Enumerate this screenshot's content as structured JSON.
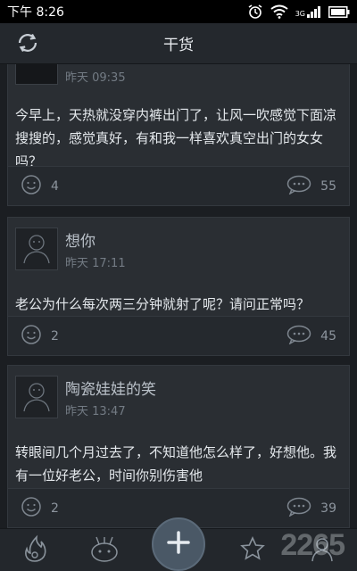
{
  "status_bar": {
    "time": "下午 8:26",
    "icons": [
      "alarm-icon",
      "wifi-icon",
      "signal-icon",
      "battery-icon"
    ],
    "network_label": "3G"
  },
  "header": {
    "title": "干货",
    "refresh_icon": "refresh-icon"
  },
  "posts": [
    {
      "username": "",
      "time": "昨天 09:35",
      "content": "今早上，天热就没穿内裤出门了，让风一吹感觉下面凉搜搜的，感觉真好，有和我一样喜欢真空出门的女女吗？",
      "likes": "4",
      "comments": "55"
    },
    {
      "username": "想你",
      "time": "昨天 17:11",
      "content": "老公为什么每次两三分钟就射了呢？请问正常吗？",
      "likes": "2",
      "comments": "45"
    },
    {
      "username": "陶瓷娃娃的笑",
      "time": "昨天 13:47",
      "content": "转眼间几个月过去了，不知道他怎么样了，好想他。我有一位好老公，时间你别伤害他",
      "likes": "2",
      "comments": "39"
    }
  ],
  "bottom_nav": {
    "items": [
      "flame-icon",
      "bug-icon",
      "add-icon",
      "star-icon",
      "profile-icon"
    ]
  },
  "watermark": "2265"
}
